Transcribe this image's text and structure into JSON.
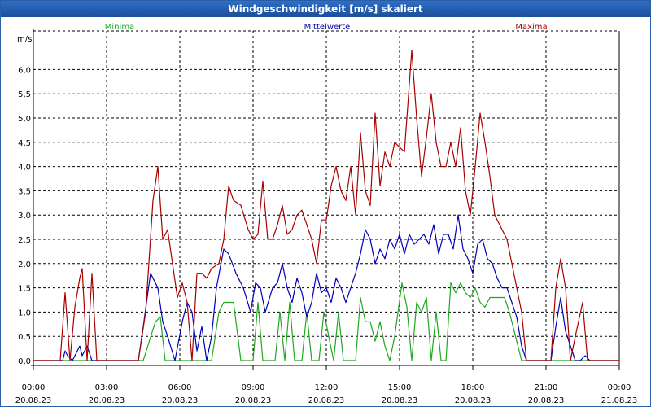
{
  "window": {
    "title": "Windgeschwindigkeit [m/s] skaliert"
  },
  "colors": {
    "min": "#1fa81f",
    "mean": "#0000b8",
    "max": "#a80000",
    "grid": "#000000"
  },
  "chart_data": {
    "type": "line",
    "title": "Windgeschwindigkeit [m/s] skaliert",
    "ylabel": "m/s",
    "xlabel": "",
    "ylim": [
      0,
      6.6
    ],
    "xlim": [
      0,
      24
    ],
    "grid": true,
    "legend_position": "top",
    "y_ticks": [
      "0,0",
      "0,5",
      "1,0",
      "1,5",
      "2,0",
      "2,5",
      "3,0",
      "3,5",
      "4,0",
      "4,5",
      "5,0",
      "5,5",
      "6,0"
    ],
    "x_ticks": [
      {
        "time": "00:00",
        "date": "20.08.23"
      },
      {
        "time": "03:00",
        "date": "20.08.23"
      },
      {
        "time": "06:00",
        "date": "20.08.23"
      },
      {
        "time": "09:00",
        "date": "20.08.23"
      },
      {
        "time": "12:00",
        "date": "20.08.23"
      },
      {
        "time": "15:00",
        "date": "20.08.23"
      },
      {
        "time": "18:00",
        "date": "20.08.23"
      },
      {
        "time": "21:00",
        "date": "20.08.23"
      },
      {
        "time": "00:00",
        "date": "21.08.23"
      }
    ],
    "series": [
      {
        "name": "Minima",
        "color": "#1fa81f",
        "points": [
          [
            0,
            0
          ],
          [
            4.5,
            0
          ],
          [
            5.0,
            0.8
          ],
          [
            5.2,
            0.9
          ],
          [
            5.4,
            0
          ],
          [
            7.3,
            0
          ],
          [
            7.6,
            1.0
          ],
          [
            7.8,
            1.2
          ],
          [
            8.2,
            1.2
          ],
          [
            8.5,
            0
          ],
          [
            9.0,
            0
          ],
          [
            9.2,
            1.2
          ],
          [
            9.4,
            0
          ],
          [
            9.9,
            0
          ],
          [
            10.1,
            1.0
          ],
          [
            10.3,
            0
          ],
          [
            10.5,
            1.2
          ],
          [
            10.7,
            0
          ],
          [
            11.0,
            0
          ],
          [
            11.2,
            1.0
          ],
          [
            11.4,
            0
          ],
          [
            11.7,
            0
          ],
          [
            11.9,
            1.0
          ],
          [
            12.1,
            0.5
          ],
          [
            12.3,
            0
          ],
          [
            12.5,
            1.0
          ],
          [
            12.7,
            0
          ],
          [
            13.2,
            0
          ],
          [
            13.4,
            1.3
          ],
          [
            13.6,
            0.8
          ],
          [
            13.8,
            0.8
          ],
          [
            14.0,
            0.4
          ],
          [
            14.2,
            0.8
          ],
          [
            14.4,
            0.3
          ],
          [
            14.6,
            0
          ],
          [
            14.8,
            0.5
          ],
          [
            15.1,
            1.6
          ],
          [
            15.3,
            1.1
          ],
          [
            15.5,
            0
          ],
          [
            15.7,
            1.2
          ],
          [
            15.9,
            1.0
          ],
          [
            16.1,
            1.3
          ],
          [
            16.3,
            0
          ],
          [
            16.5,
            1.0
          ],
          [
            16.7,
            0
          ],
          [
            16.9,
            0
          ],
          [
            17.1,
            1.6
          ],
          [
            17.3,
            1.4
          ],
          [
            17.5,
            1.6
          ],
          [
            17.7,
            1.4
          ],
          [
            17.9,
            1.3
          ],
          [
            18.1,
            1.5
          ],
          [
            18.3,
            1.2
          ],
          [
            18.5,
            1.1
          ],
          [
            18.7,
            1.3
          ],
          [
            19.3,
            1.3
          ],
          [
            19.5,
            1.0
          ],
          [
            20.0,
            0
          ],
          [
            24,
            0
          ]
        ]
      },
      {
        "name": "Mittelwerte",
        "color": "#0000b8",
        "points": [
          [
            0,
            0
          ],
          [
            1.2,
            0
          ],
          [
            1.3,
            0.2
          ],
          [
            1.4,
            0.1
          ],
          [
            1.6,
            0
          ],
          [
            1.9,
            0.3
          ],
          [
            2.0,
            0.1
          ],
          [
            2.2,
            0.3
          ],
          [
            2.4,
            0
          ],
          [
            4.3,
            0
          ],
          [
            4.5,
            0.7
          ],
          [
            4.8,
            1.8
          ],
          [
            5.1,
            1.5
          ],
          [
            5.3,
            0.8
          ],
          [
            5.5,
            0.5
          ],
          [
            5.8,
            0
          ],
          [
            6.1,
            0.8
          ],
          [
            6.3,
            1.2
          ],
          [
            6.5,
            1.0
          ],
          [
            6.7,
            0.2
          ],
          [
            6.9,
            0.7
          ],
          [
            7.1,
            0
          ],
          [
            7.3,
            0.5
          ],
          [
            7.5,
            1.5
          ],
          [
            7.8,
            2.3
          ],
          [
            8.0,
            2.2
          ],
          [
            8.3,
            1.8
          ],
          [
            8.6,
            1.5
          ],
          [
            8.9,
            1.0
          ],
          [
            9.1,
            1.6
          ],
          [
            9.3,
            1.5
          ],
          [
            9.5,
            1.0
          ],
          [
            9.8,
            1.5
          ],
          [
            10.0,
            1.6
          ],
          [
            10.2,
            2.0
          ],
          [
            10.4,
            1.5
          ],
          [
            10.6,
            1.2
          ],
          [
            10.8,
            1.7
          ],
          [
            11.0,
            1.4
          ],
          [
            11.2,
            0.9
          ],
          [
            11.4,
            1.2
          ],
          [
            11.6,
            1.8
          ],
          [
            11.8,
            1.4
          ],
          [
            12.0,
            1.5
          ],
          [
            12.2,
            1.2
          ],
          [
            12.4,
            1.7
          ],
          [
            12.6,
            1.5
          ],
          [
            12.8,
            1.2
          ],
          [
            13.0,
            1.5
          ],
          [
            13.2,
            1.8
          ],
          [
            13.4,
            2.2
          ],
          [
            13.6,
            2.7
          ],
          [
            13.8,
            2.5
          ],
          [
            14.0,
            2.0
          ],
          [
            14.2,
            2.3
          ],
          [
            14.4,
            2.1
          ],
          [
            14.6,
            2.5
          ],
          [
            14.8,
            2.3
          ],
          [
            15.0,
            2.6
          ],
          [
            15.2,
            2.2
          ],
          [
            15.4,
            2.6
          ],
          [
            15.6,
            2.4
          ],
          [
            15.8,
            2.5
          ],
          [
            16.0,
            2.6
          ],
          [
            16.2,
            2.4
          ],
          [
            16.4,
            2.8
          ],
          [
            16.6,
            2.2
          ],
          [
            16.8,
            2.6
          ],
          [
            17.0,
            2.6
          ],
          [
            17.2,
            2.3
          ],
          [
            17.4,
            3.0
          ],
          [
            17.6,
            2.3
          ],
          [
            17.8,
            2.1
          ],
          [
            18.0,
            1.8
          ],
          [
            18.2,
            2.4
          ],
          [
            18.4,
            2.5
          ],
          [
            18.6,
            2.1
          ],
          [
            18.8,
            2.0
          ],
          [
            19.0,
            1.7
          ],
          [
            19.2,
            1.5
          ],
          [
            19.4,
            1.5
          ],
          [
            19.6,
            1.2
          ],
          [
            19.8,
            0.9
          ],
          [
            20.0,
            0.3
          ],
          [
            20.2,
            0
          ],
          [
            21.2,
            0
          ],
          [
            21.4,
            0.7
          ],
          [
            21.6,
            1.3
          ],
          [
            21.8,
            0.6
          ],
          [
            22.0,
            0.3
          ],
          [
            22.2,
            0
          ],
          [
            22.4,
            0
          ],
          [
            22.6,
            0.1
          ],
          [
            22.8,
            0
          ],
          [
            24,
            0
          ]
        ]
      },
      {
        "name": "Maxima",
        "color": "#a80000",
        "points": [
          [
            0,
            0
          ],
          [
            1.1,
            0
          ],
          [
            1.3,
            1.4
          ],
          [
            1.5,
            0
          ],
          [
            1.7,
            1.1
          ],
          [
            1.9,
            1.7
          ],
          [
            2.0,
            1.9
          ],
          [
            2.2,
            0
          ],
          [
            2.4,
            1.8
          ],
          [
            2.6,
            0
          ],
          [
            4.3,
            0
          ],
          [
            4.6,
            1.0
          ],
          [
            4.9,
            3.3
          ],
          [
            5.1,
            4.0
          ],
          [
            5.3,
            2.5
          ],
          [
            5.5,
            2.7
          ],
          [
            5.7,
            2.0
          ],
          [
            5.9,
            1.3
          ],
          [
            6.1,
            1.6
          ],
          [
            6.3,
            1.2
          ],
          [
            6.5,
            0
          ],
          [
            6.7,
            1.8
          ],
          [
            6.9,
            1.8
          ],
          [
            7.1,
            1.7
          ],
          [
            7.3,
            1.9
          ],
          [
            7.6,
            2.0
          ],
          [
            7.8,
            2.5
          ],
          [
            8.0,
            3.6
          ],
          [
            8.2,
            3.3
          ],
          [
            8.5,
            3.2
          ],
          [
            8.8,
            2.7
          ],
          [
            9.0,
            2.5
          ],
          [
            9.2,
            2.6
          ],
          [
            9.4,
            3.7
          ],
          [
            9.6,
            2.5
          ],
          [
            9.8,
            2.5
          ],
          [
            10.0,
            2.8
          ],
          [
            10.2,
            3.2
          ],
          [
            10.4,
            2.6
          ],
          [
            10.6,
            2.7
          ],
          [
            10.8,
            3.0
          ],
          [
            11.0,
            3.1
          ],
          [
            11.2,
            2.8
          ],
          [
            11.4,
            2.5
          ],
          [
            11.6,
            2.0
          ],
          [
            11.8,
            2.9
          ],
          [
            12.0,
            2.9
          ],
          [
            12.2,
            3.6
          ],
          [
            12.4,
            4.0
          ],
          [
            12.6,
            3.5
          ],
          [
            12.8,
            3.3
          ],
          [
            13.0,
            4.0
          ],
          [
            13.2,
            3.0
          ],
          [
            13.4,
            4.7
          ],
          [
            13.6,
            3.5
          ],
          [
            13.8,
            3.2
          ],
          [
            14.0,
            5.1
          ],
          [
            14.2,
            3.6
          ],
          [
            14.4,
            4.3
          ],
          [
            14.6,
            4.0
          ],
          [
            14.8,
            4.5
          ],
          [
            15.0,
            4.4
          ],
          [
            15.2,
            4.3
          ],
          [
            15.5,
            6.4
          ],
          [
            15.7,
            5.0
          ],
          [
            15.9,
            3.8
          ],
          [
            16.1,
            4.6
          ],
          [
            16.3,
            5.5
          ],
          [
            16.5,
            4.5
          ],
          [
            16.7,
            4.0
          ],
          [
            16.9,
            4.0
          ],
          [
            17.1,
            4.5
          ],
          [
            17.3,
            4.0
          ],
          [
            17.5,
            4.8
          ],
          [
            17.7,
            3.5
          ],
          [
            17.9,
            3.0
          ],
          [
            18.1,
            4.0
          ],
          [
            18.3,
            5.1
          ],
          [
            18.5,
            4.5
          ],
          [
            18.7,
            3.8
          ],
          [
            18.9,
            3.0
          ],
          [
            19.1,
            2.8
          ],
          [
            19.4,
            2.5
          ],
          [
            19.6,
            2.0
          ],
          [
            19.8,
            1.5
          ],
          [
            20.0,
            1.0
          ],
          [
            20.2,
            0
          ],
          [
            21.2,
            0
          ],
          [
            21.4,
            1.5
          ],
          [
            21.6,
            2.1
          ],
          [
            21.8,
            1.5
          ],
          [
            22.0,
            0
          ],
          [
            22.2,
            0.5
          ],
          [
            22.5,
            1.2
          ],
          [
            22.7,
            0
          ],
          [
            24,
            0
          ]
        ]
      }
    ]
  }
}
